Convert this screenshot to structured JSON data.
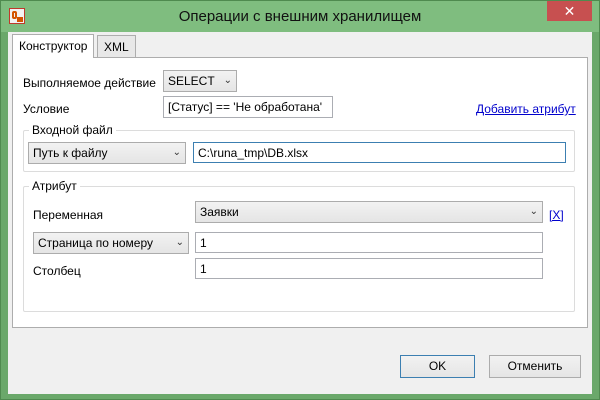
{
  "window": {
    "title": "Операции с внешним хранилищем",
    "close_glyph": "✕"
  },
  "tabs": [
    {
      "label": "Конструктор",
      "active": true
    },
    {
      "label": "XML",
      "active": false
    }
  ],
  "action": {
    "label": "Выполняемое действие",
    "value": "SELECT"
  },
  "condition": {
    "label": "Условие",
    "value": "[Статус] == 'Не обработана'",
    "add_attribute_link": "Добавить атрибут"
  },
  "input_file": {
    "group_title": "Входной файл",
    "mode": "Путь к файлу",
    "path": "C:\\runa_tmp\\DB.xlsx"
  },
  "attribute": {
    "group_title": "Атрибут",
    "variable_label": "Переменная",
    "variable_value": "Заявки",
    "remove_link": "[X]",
    "page_mode": "Страница по номеру",
    "page_value": "1",
    "column_label": "Столбец",
    "column_value": "1"
  },
  "buttons": {
    "ok": "OK",
    "cancel": "Отменить"
  },
  "icons": {
    "chevron": "chevron-down-icon",
    "app": "app-icon",
    "close": "close-icon"
  }
}
